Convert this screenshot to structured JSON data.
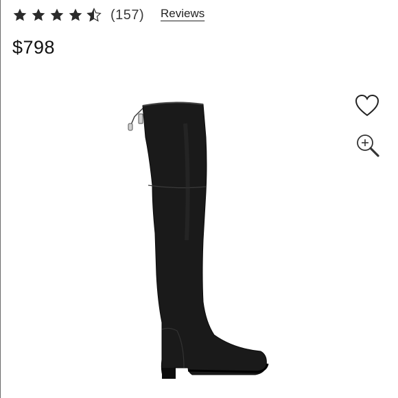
{
  "product": {
    "rating": 4.5,
    "rating_max": 5,
    "review_count": "(157)",
    "reviews_link": "Reviews",
    "price": "$798",
    "image_icon": "over-the-knee-boot"
  },
  "actions": {
    "wishlist_icon": "heart-icon",
    "zoom_icon": "zoom-in-icon"
  }
}
